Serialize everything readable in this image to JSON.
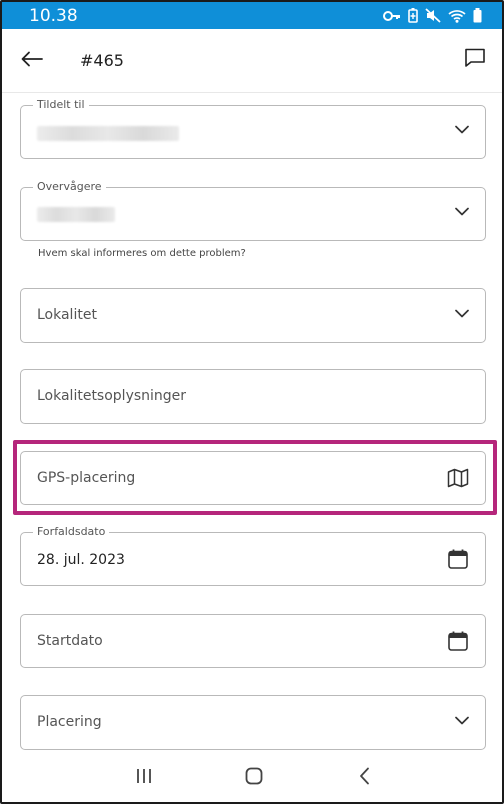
{
  "status_bar": {
    "time": "10.38",
    "icons": [
      "key-icon",
      "battery-saver-icon",
      "mute-icon",
      "wifi-icon",
      "battery-icon"
    ]
  },
  "app_bar": {
    "title": "#465",
    "back_icon": "arrow-left-icon",
    "chat_icon": "comment-icon"
  },
  "form": {
    "assigned_to": {
      "label": "Tildelt til",
      "value": ""
    },
    "watchers": {
      "label": "Overvågere",
      "value": "",
      "helper": "Hvem skal informeres om dette problem?"
    },
    "location": {
      "placeholder": "Lokalitet"
    },
    "location_info": {
      "placeholder": "Lokalitetsoplysninger"
    },
    "gps": {
      "placeholder": "GPS-placering",
      "icon": "map-icon"
    },
    "due_date": {
      "label": "Forfaldsdato",
      "value": "28. jul. 2023",
      "icon": "calendar-icon"
    },
    "start_date": {
      "placeholder": "Startdato",
      "icon": "calendar-icon"
    },
    "placement": {
      "placeholder": "Placering"
    }
  },
  "colors": {
    "status_bar": "#0f8fd8",
    "highlight": "#b5267b",
    "field_border": "#b9b9b9"
  },
  "nav_bar": {
    "icons": [
      "recent-apps-icon",
      "home-icon",
      "back-nav-icon"
    ]
  }
}
